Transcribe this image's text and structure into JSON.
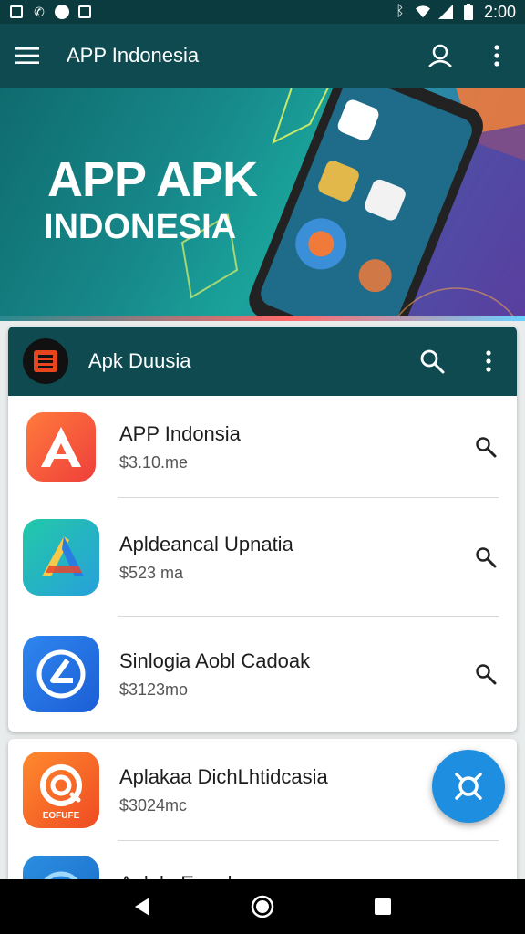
{
  "status_bar": {
    "time": "2:00",
    "left_icons": [
      "notification-icon",
      "missed-call-icon",
      "app-notification-icon",
      "screenshot-icon"
    ],
    "right_icons": [
      "bluetooth-icon",
      "wifi-icon",
      "signal-icon",
      "battery-icon"
    ]
  },
  "app_bar": {
    "title": "APP Indonesia",
    "icons": [
      "menu-icon",
      "account-icon",
      "more-vert-icon"
    ]
  },
  "banner": {
    "line1": "APP APK",
    "line2": "INDONESIA"
  },
  "section": {
    "title": "Apk Duusia",
    "icons": [
      "search-icon",
      "more-vert-icon"
    ]
  },
  "apps": [
    {
      "name": "APP Indonsia",
      "price": "$3.10.me",
      "icon": "a-logo-icon",
      "colors": [
        "#ff6b3d",
        "#f0483a"
      ]
    },
    {
      "name": "Apldeancal Upnatia",
      "price": "$523 ma",
      "icon": "a-prism-icon",
      "colors": [
        "#1fc4b0",
        "#25a4d8"
      ]
    },
    {
      "name": "Sinlogia Aobl Cadoak",
      "price": "$3123mo",
      "icon": "l-circle-icon",
      "colors": [
        "#2a7be8",
        "#1c5fd6"
      ]
    },
    {
      "name": "Aplakaa DichLhtidcasia",
      "price": "$3024mc",
      "icon": "target-icon",
      "colors": [
        "#ff7a2a",
        "#f04e24"
      ],
      "badge": "EOFUFE"
    },
    {
      "name": "Aplala Eunala",
      "price": "",
      "icon": "blue-circle-icon",
      "colors": [
        "#2a8ee0",
        "#1a6cc8"
      ]
    }
  ],
  "fab": {
    "icon": "connect-icon"
  },
  "nav": {
    "icons": [
      "back-icon",
      "home-icon",
      "recents-icon"
    ]
  }
}
